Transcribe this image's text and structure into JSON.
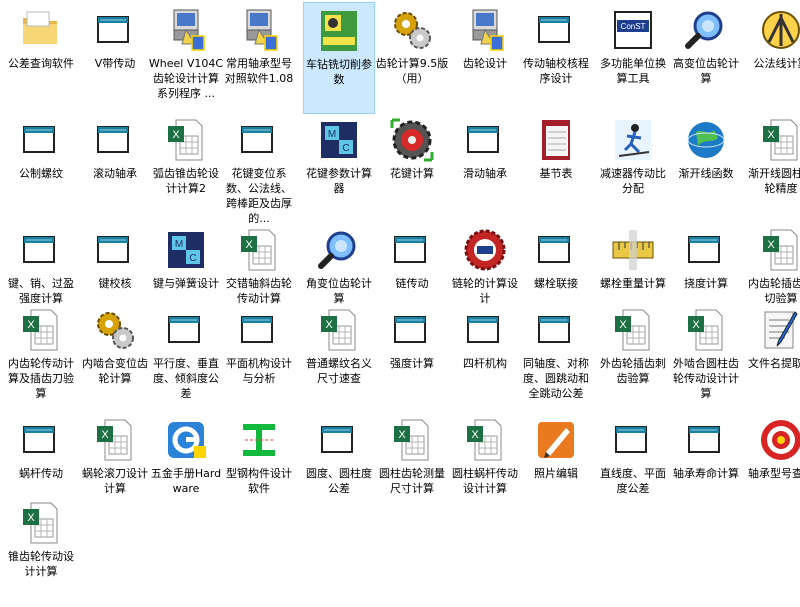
{
  "desktop": {
    "rows": [
      [
        {
          "label": "公差查询软件",
          "icon": "folder-icon"
        },
        {
          "label": "V带传动",
          "icon": "window-icon"
        },
        {
          "label": "Wheel V104C 齿轮设计计算系列程序 ...",
          "icon": "installer-icon"
        },
        {
          "label": "常用轴承型号对照软件1.08",
          "icon": "installer-icon"
        },
        {
          "label": "车钻铣切削参数",
          "icon": "noyes-icon",
          "selected": true
        },
        {
          "label": "齿轮计算9.5版（用）",
          "icon": "gears-icon"
        },
        {
          "label": "齿轮设计",
          "icon": "installer-icon"
        },
        {
          "label": "传动轴校核程序设计",
          "icon": "window-icon"
        },
        {
          "label": "多功能单位换算工具",
          "icon": "conset-icon"
        },
        {
          "label": "高变位齿轮计算",
          "icon": "magnifier-icon"
        },
        {
          "label": "公法线计算",
          "icon": "compass-icon"
        }
      ],
      [
        {
          "label": "公制螺纹",
          "icon": "window-icon"
        },
        {
          "label": "滚动轴承",
          "icon": "window-icon"
        },
        {
          "label": "弧齿锥齿轮设计计算2",
          "icon": "excel-icon"
        },
        {
          "label": "花键变位系数、公法线、跨棒距及齿厚的...",
          "icon": "window-icon"
        },
        {
          "label": "花键参数计算器",
          "icon": "mc-cube-icon"
        },
        {
          "label": "花键计算",
          "icon": "gear-disc-icon"
        },
        {
          "label": "滑动轴承",
          "icon": "window-icon"
        },
        {
          "label": "基节表",
          "icon": "book-icon"
        },
        {
          "label": "减速器传动比分配",
          "icon": "skier-icon"
        },
        {
          "label": "渐开线函数",
          "icon": "globe-icon"
        },
        {
          "label": "渐开线圆柱齿轮精度",
          "icon": "excel-icon"
        }
      ],
      [
        {
          "label": "键、销、过盈强度计算",
          "icon": "window-icon"
        },
        {
          "label": "键校核",
          "icon": "window-icon"
        },
        {
          "label": "键与弹簧设计",
          "icon": "mc-cube-icon"
        },
        {
          "label": "交错轴斜齿轮传动计算",
          "icon": "excel-icon"
        },
        {
          "label": "角变位齿轮计算",
          "icon": "magnifier-icon"
        },
        {
          "label": "链传动",
          "icon": "window-icon"
        },
        {
          "label": "链轮的计算设计",
          "icon": "design-badge-icon"
        },
        {
          "label": "螺栓联接",
          "icon": "window-icon"
        },
        {
          "label": "螺栓重量计算",
          "icon": "ruler-icon"
        },
        {
          "label": "挠度计算",
          "icon": "window-icon"
        },
        {
          "label": "内齿轮插齿顶切验算",
          "icon": "excel-icon"
        }
      ],
      [
        {
          "label": "内齿轮传动计算及插齿刀验算",
          "icon": "excel-icon"
        },
        {
          "label": "内啮合变位齿轮计算",
          "icon": "gears-icon"
        },
        {
          "label": "平行度、垂直度、倾斜度公差",
          "icon": "window-icon"
        },
        {
          "label": "平面机构设计与分析",
          "icon": "window-icon"
        },
        {
          "label": "普通螺纹名义尺寸速查",
          "icon": "excel-icon"
        },
        {
          "label": "强度计算",
          "icon": "window-icon"
        },
        {
          "label": "四杆机构",
          "icon": "window-icon"
        },
        {
          "label": "同轴度、对称度、圆跳动和全跳动公差",
          "icon": "window-icon"
        },
        {
          "label": "外齿轮插齿刺齿验算",
          "icon": "excel-icon"
        },
        {
          "label": "外啮合圆柱齿轮传动设计计算",
          "icon": "excel-icon"
        },
        {
          "label": "文件名提取器",
          "icon": "notepad-pen-icon"
        }
      ],
      [
        {
          "label": "蜗杆传动",
          "icon": "window-icon"
        },
        {
          "label": "蜗轮滚刀设计计算",
          "icon": "excel-icon"
        },
        {
          "label": "五金手册Hardware",
          "icon": "g-shield-icon"
        },
        {
          "label": "型钢构件设计软件",
          "icon": "ibeam-icon"
        },
        {
          "label": "圆度、圆柱度公差",
          "icon": "window-icon"
        },
        {
          "label": "圆柱齿轮测量尺寸计算",
          "icon": "excel-icon"
        },
        {
          "label": "圆柱蜗杆传动设计计算",
          "icon": "excel-icon"
        },
        {
          "label": "照片编辑",
          "icon": "photo-edit-icon"
        },
        {
          "label": "直线度、平面度公差",
          "icon": "window-icon"
        },
        {
          "label": "轴承寿命计算",
          "icon": "window-icon"
        },
        {
          "label": "轴承型号查询",
          "icon": "target-icon"
        }
      ],
      [
        {
          "label": "锥齿轮传动设计计算",
          "icon": "excel-icon"
        }
      ]
    ]
  }
}
